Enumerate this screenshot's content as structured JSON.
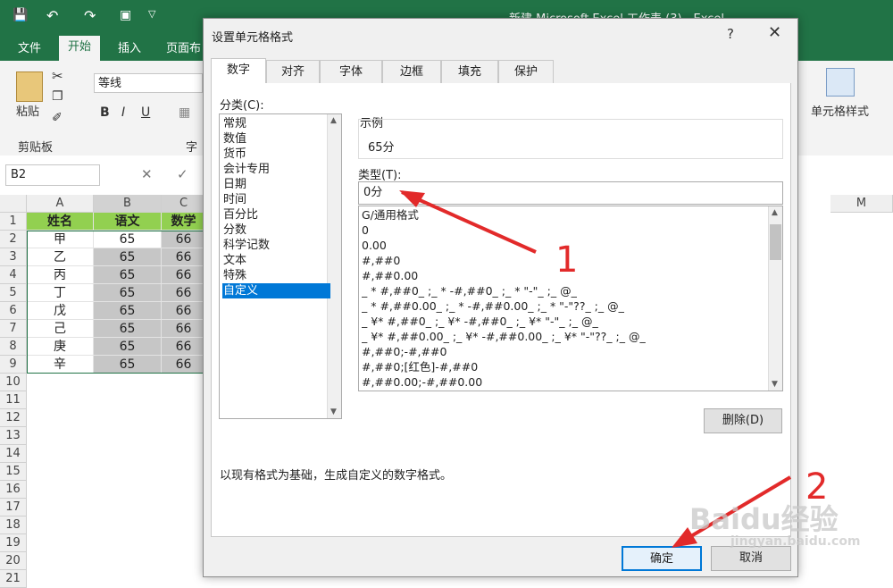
{
  "excel": {
    "window_title": "新建 Microsoft Excel 工作表 (3) - Excel",
    "ribbon_tabs": [
      "文件",
      "开始",
      "插入",
      "页面布"
    ],
    "active_tab": "开始",
    "clipboard": {
      "paste_label": "粘贴",
      "group_label": "剪贴板"
    },
    "font_name": "等线",
    "font_group_partial": "字",
    "cell_style_label": "单元格样式",
    "name_box": "B2",
    "columns": [
      "A",
      "B",
      "C",
      "M"
    ],
    "rows": [
      "1",
      "2",
      "3",
      "4",
      "5",
      "6",
      "7",
      "8",
      "9",
      "10",
      "11",
      "12",
      "13",
      "14",
      "15",
      "16",
      "17",
      "18",
      "19",
      "20",
      "21"
    ],
    "table": {
      "headers": [
        "姓名",
        "语文",
        "数学"
      ],
      "names": [
        "甲",
        "乙",
        "丙",
        "丁",
        "戊",
        "己",
        "庚",
        "辛"
      ],
      "chinese": [
        "65",
        "65",
        "65",
        "65",
        "65",
        "65",
        "65",
        "65"
      ],
      "math": [
        "66",
        "66",
        "66",
        "66",
        "66",
        "66",
        "66",
        "66"
      ]
    }
  },
  "dialog": {
    "title": "设置单元格格式",
    "help": "?",
    "close": "✕",
    "tabs": [
      "数字",
      "对齐",
      "字体",
      "边框",
      "填充",
      "保护"
    ],
    "active_tab": "数字",
    "category_label": "分类(C):",
    "categories": [
      "常规",
      "数值",
      "货币",
      "会计专用",
      "日期",
      "时间",
      "百分比",
      "分数",
      "科学记数",
      "文本",
      "特殊",
      "自定义"
    ],
    "selected_category": "自定义",
    "sample_label": "示例",
    "sample_value": "65分",
    "type_label": "类型(T):",
    "type_value": "0分",
    "formats": [
      "G/通用格式",
      "0",
      "0.00",
      "#,##0",
      "#,##0.00",
      "_ * #,##0_ ;_ * -#,##0_ ;_ * \"-\"_ ;_ @_",
      "_ * #,##0.00_ ;_ * -#,##0.00_ ;_ * \"-\"??_ ;_ @_",
      "_ ¥* #,##0_ ;_ ¥* -#,##0_ ;_ ¥* \"-\"_ ;_ @_",
      "_ ¥* #,##0.00_ ;_ ¥* -#,##0.00_ ;_ ¥* \"-\"??_ ;_ @_",
      "#,##0;-#,##0",
      "#,##0;[红色]-#,##0",
      "#,##0.00;-#,##0.00"
    ],
    "delete_button": "删除(D)",
    "description": "以现有格式为基础，生成自定义的数字格式。",
    "ok_button": "确定",
    "cancel_button": "取消"
  },
  "annotations": {
    "step1": "1",
    "step2": "2",
    "color": "#e22a2a"
  },
  "watermark": {
    "brand": "Baidu经验",
    "url": "jingyan.baidu.com"
  }
}
